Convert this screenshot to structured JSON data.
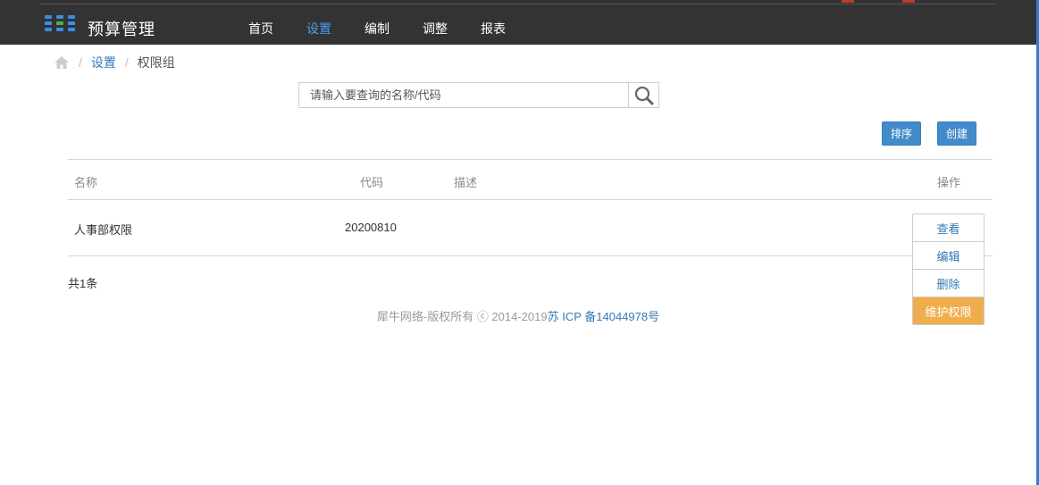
{
  "header": {
    "brand": "预算管理",
    "nav": [
      {
        "label": "首页",
        "active": false
      },
      {
        "label": "设置",
        "active": true
      },
      {
        "label": "编制",
        "active": false
      },
      {
        "label": "调整",
        "active": false
      },
      {
        "label": "报表",
        "active": false
      }
    ],
    "accent_color": "#4a9ff5"
  },
  "breadcrumb": {
    "home_icon": "home-icon",
    "items": [
      {
        "label": "设置"
      },
      {
        "label": "权限组"
      }
    ]
  },
  "search": {
    "placeholder": "请输入要查询的名称/代码",
    "value": "",
    "icon": "search-icon"
  },
  "toolbar": {
    "sort_label": "排序",
    "create_label": "创建"
  },
  "table": {
    "columns": [
      "名称",
      "代码",
      "描述",
      "操作"
    ],
    "rows": [
      {
        "name": "人事部权限",
        "code": "20200810",
        "description": "",
        "actions": [
          "查看",
          "编辑",
          "删除",
          "维护权限"
        ]
      }
    ]
  },
  "total_text": "共1条",
  "footer": {
    "copyright": "犀牛网络-版权所有 ⓒ 2014-2019",
    "icp": "苏 ICP 备14044978号"
  }
}
